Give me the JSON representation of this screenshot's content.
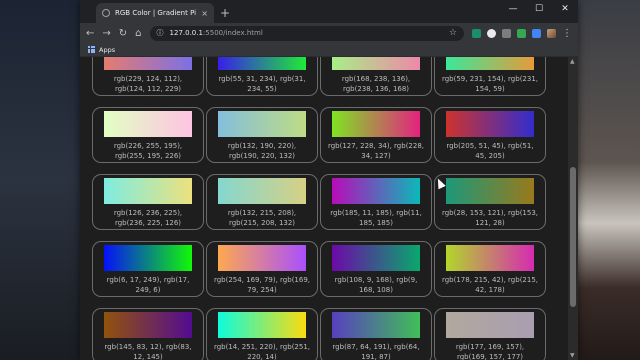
{
  "window": {
    "tab_title": "RGB Color | Gradient Picker",
    "tab_close": "×",
    "new_tab": "+",
    "minimize": "—",
    "maximize": "☐",
    "close": "✕"
  },
  "toolbar": {
    "back": "←",
    "forward": "→",
    "reload": "↻",
    "home": "⌂",
    "info": "ⓘ",
    "host": "127.0.0.1",
    "path": ":5500/index.html",
    "star": "☆",
    "menu": "⋮"
  },
  "bookmarks": {
    "apps_label": "Apps"
  },
  "cards": [
    {
      "from": "rgb(229, 124, 112)",
      "to": "rgb(124, 112, 229)",
      "label": "rgb(229, 124, 112), rgb(124, 112, 229)"
    },
    {
      "from": "rgb(55, 31, 234)",
      "to": "rgb(31, 234, 55)",
      "label": "rgb(55, 31, 234), rgb(31, 234, 55)"
    },
    {
      "from": "rgb(168, 238, 136)",
      "to": "rgb(238, 136, 168)",
      "label": "rgb(168, 238, 136), rgb(238, 136, 168)"
    },
    {
      "from": "rgb(59, 231, 154)",
      "to": "rgb(231, 154, 59)",
      "label": "rgb(59, 231, 154), rgb(231, 154, 59)"
    },
    {
      "from": "rgb(226, 255, 195)",
      "to": "rgb(255, 195, 226)",
      "label": "rgb(226, 255, 195), rgb(255, 195, 226)"
    },
    {
      "from": "rgb(132, 190, 220)",
      "to": "rgb(190, 220, 132)",
      "label": "rgb(132, 190, 220), rgb(190, 220, 132)"
    },
    {
      "from": "rgb(127, 228, 34)",
      "to": "rgb(228, 34, 127)",
      "label": "rgb(127, 228, 34), rgb(228, 34, 127)"
    },
    {
      "from": "rgb(205, 51, 45)",
      "to": "rgb(51, 45, 205)",
      "label": "rgb(205, 51, 45), rgb(51, 45, 205)"
    },
    {
      "from": "rgb(126, 236, 225)",
      "to": "rgb(236, 225, 126)",
      "label": "rgb(126, 236, 225), rgb(236, 225, 126)"
    },
    {
      "from": "rgb(132, 215, 208)",
      "to": "rgb(215, 208, 132)",
      "label": "rgb(132, 215, 208), rgb(215, 208, 132)"
    },
    {
      "from": "rgb(185, 11, 185)",
      "to": "rgb(11, 185, 185)",
      "label": "rgb(185, 11, 185), rgb(11, 185, 185)"
    },
    {
      "from": "rgb(28, 153, 121)",
      "to": "rgb(153, 121, 28)",
      "label": "rgb(28, 153, 121), rgb(153, 121, 28)"
    },
    {
      "from": "rgb(6, 17, 249)",
      "to": "rgb(17, 249, 6)",
      "label": "rgb(6, 17, 249), rgb(17, 249, 6)"
    },
    {
      "from": "rgb(254, 169, 79)",
      "to": "rgb(169, 79, 254)",
      "label": "rgb(254, 169, 79), rgb(169, 79, 254)"
    },
    {
      "from": "rgb(108, 9, 168)",
      "to": "rgb(9, 168, 108)",
      "label": "rgb(108, 9, 168), rgb(9, 168, 108)"
    },
    {
      "from": "rgb(178, 215, 42)",
      "to": "rgb(215, 42, 178)",
      "label": "rgb(178, 215, 42), rgb(215, 42, 178)"
    },
    {
      "from": "rgb(145, 83, 12)",
      "to": "rgb(83, 12, 145)",
      "label": "rgb(145, 83, 12), rgb(83, 12, 145)"
    },
    {
      "from": "rgb(14, 251, 220)",
      "to": "rgb(251, 220, 14)",
      "label": "rgb(14, 251, 220), rgb(251, 220, 14)"
    },
    {
      "from": "rgb(87, 64, 191)",
      "to": "rgb(64, 191, 87)",
      "label": "rgb(87, 64, 191), rgb(64, 191, 87)"
    },
    {
      "from": "rgb(177, 169, 157)",
      "to": "rgb(169, 157, 177)",
      "label": "rgb(177, 169, 157), rgb(169, 157, 177)"
    }
  ],
  "colors": {
    "page_bg": "#1e1e1e",
    "card_border": "#6b6b6b",
    "label_text": "#bdbdbd"
  }
}
